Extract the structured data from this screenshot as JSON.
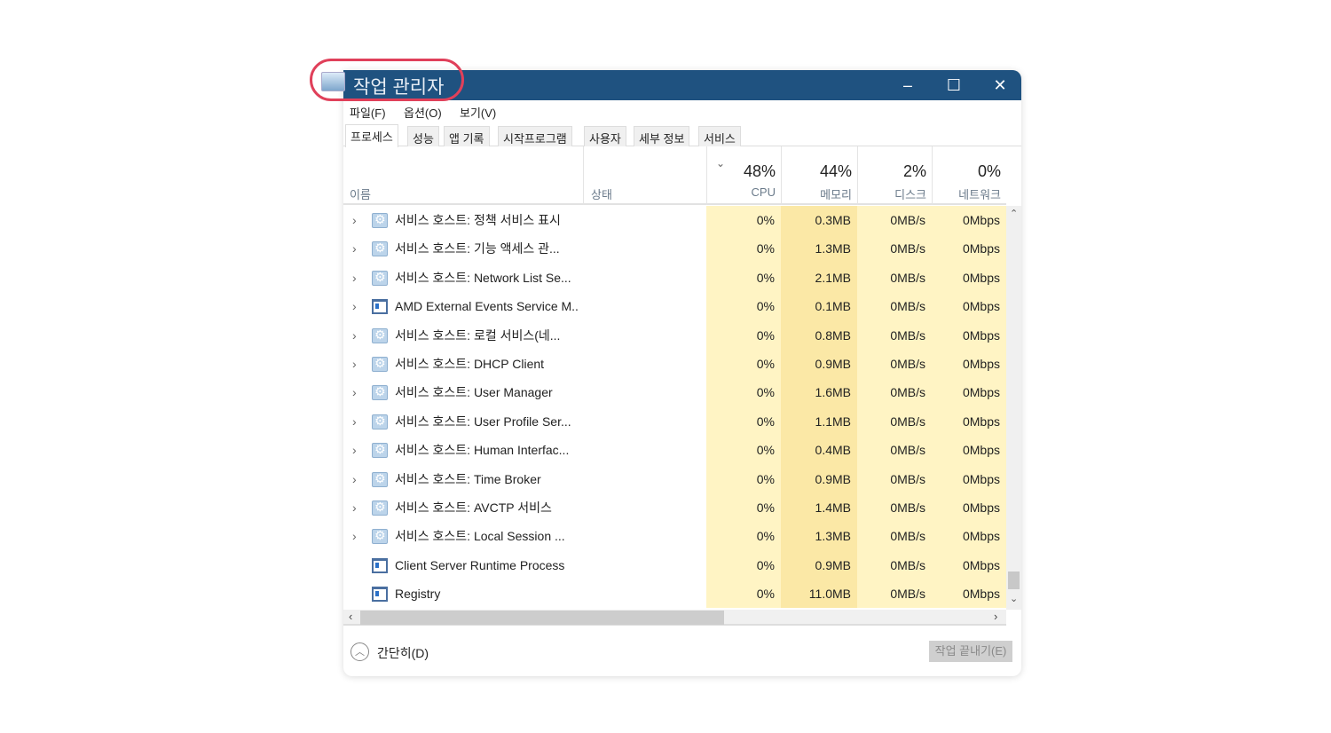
{
  "window": {
    "title": "작업 관리자",
    "minimize": "–",
    "maximize": "☐",
    "close": "✕"
  },
  "menu": [
    "파일(F)",
    "옵션(O)",
    "보기(V)"
  ],
  "tabs": [
    "프로세스",
    "성능",
    "앱 기록",
    "시작프로그램",
    "사용자",
    "세부 정보",
    "서비스"
  ],
  "columns": {
    "name": "이름",
    "status": "상태",
    "cpu": {
      "pct": "48%",
      "label": "CPU"
    },
    "memory": {
      "pct": "44%",
      "label": "메모리"
    },
    "disk": {
      "pct": "2%",
      "label": "디스크"
    },
    "network": {
      "pct": "0%",
      "label": "네트워크"
    }
  },
  "rows": [
    {
      "name": "서비스 호스트: 정책 서비스 표시",
      "icon": "gear",
      "expand": true,
      "cpu": "0%",
      "mem": "0.3MB",
      "disk": "0MB/s",
      "net": "0Mbps"
    },
    {
      "name": "서비스 호스트: 기능 액세스 관...",
      "icon": "gear",
      "expand": true,
      "cpu": "0%",
      "mem": "1.3MB",
      "disk": "0MB/s",
      "net": "0Mbps"
    },
    {
      "name": "서비스 호스트: Network List Se...",
      "icon": "gear",
      "expand": true,
      "cpu": "0%",
      "mem": "2.1MB",
      "disk": "0MB/s",
      "net": "0Mbps"
    },
    {
      "name": "AMD External Events Service M...",
      "icon": "window",
      "expand": true,
      "cpu": "0%",
      "mem": "0.1MB",
      "disk": "0MB/s",
      "net": "0Mbps"
    },
    {
      "name": "서비스 호스트: 로컬 서비스(네...",
      "icon": "gear",
      "expand": true,
      "cpu": "0%",
      "mem": "0.8MB",
      "disk": "0MB/s",
      "net": "0Mbps"
    },
    {
      "name": "서비스 호스트: DHCP Client",
      "icon": "gear",
      "expand": true,
      "cpu": "0%",
      "mem": "0.9MB",
      "disk": "0MB/s",
      "net": "0Mbps"
    },
    {
      "name": "서비스 호스트: User Manager",
      "icon": "gear",
      "expand": true,
      "cpu": "0%",
      "mem": "1.6MB",
      "disk": "0MB/s",
      "net": "0Mbps"
    },
    {
      "name": "서비스 호스트: User Profile Ser...",
      "icon": "gear",
      "expand": true,
      "cpu": "0%",
      "mem": "1.1MB",
      "disk": "0MB/s",
      "net": "0Mbps"
    },
    {
      "name": "서비스 호스트: Human Interfac...",
      "icon": "gear",
      "expand": true,
      "cpu": "0%",
      "mem": "0.4MB",
      "disk": "0MB/s",
      "net": "0Mbps"
    },
    {
      "name": "서비스 호스트: Time Broker",
      "icon": "gear",
      "expand": true,
      "cpu": "0%",
      "mem": "0.9MB",
      "disk": "0MB/s",
      "net": "0Mbps"
    },
    {
      "name": "서비스 호스트: AVCTP 서비스",
      "icon": "gear",
      "expand": true,
      "cpu": "0%",
      "mem": "1.4MB",
      "disk": "0MB/s",
      "net": "0Mbps"
    },
    {
      "name": "서비스 호스트: Local Session ...",
      "icon": "gear",
      "expand": true,
      "cpu": "0%",
      "mem": "1.3MB",
      "disk": "0MB/s",
      "net": "0Mbps"
    },
    {
      "name": "Client Server Runtime Process",
      "icon": "window",
      "expand": false,
      "cpu": "0%",
      "mem": "0.9MB",
      "disk": "0MB/s",
      "net": "0Mbps"
    },
    {
      "name": "Registry",
      "icon": "window",
      "expand": false,
      "cpu": "0%",
      "mem": "11.0MB",
      "disk": "0MB/s",
      "net": "0Mbps"
    }
  ],
  "footer": {
    "fewer_details": "간단히(D)",
    "end_task": "작업 끝내기(E)"
  },
  "colors": {
    "titlebar": "#1f5280",
    "highlight": "#e0405a",
    "cpu_cell": "#fff4c4",
    "mem_cell": "#fbe8a6"
  }
}
